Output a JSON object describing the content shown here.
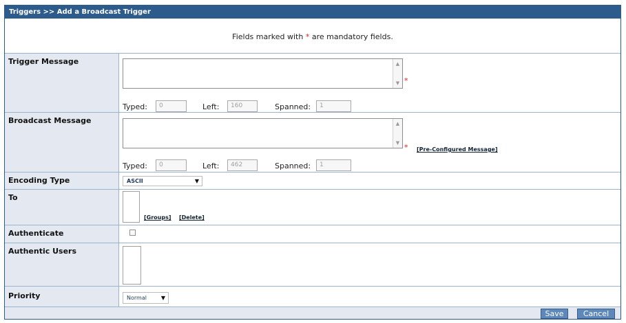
{
  "breadcrumb": "Triggers >> Add a Broadcast Trigger",
  "notice": {
    "before": "Fields marked with",
    "star": "*",
    "after": "are mandatory fields."
  },
  "trigger_message": {
    "label": "Trigger Message",
    "value": "",
    "required_star": "*",
    "typed_label": "Typed:",
    "typed": "0",
    "left_label": "Left:",
    "left": "160",
    "spanned_label": "Spanned:",
    "spanned": "1"
  },
  "broadcast_message": {
    "label": "Broadcast Message",
    "value": "",
    "required_star": "*",
    "preconfigured_link": "[Pre-Configured Message]",
    "typed_label": "Typed:",
    "typed": "0",
    "left_label": "Left:",
    "left": "462",
    "spanned_label": "Spanned:",
    "spanned": "1"
  },
  "encoding": {
    "label": "Encoding Type",
    "selected": "ASCII"
  },
  "to": {
    "label": "To",
    "groups_link": "[Groups]",
    "delete_link": "[Delete]"
  },
  "authenticate": {
    "label": "Authenticate",
    "checked": false
  },
  "authentic_users": {
    "label": "Authentic Users"
  },
  "priority": {
    "label": "Priority",
    "selected": "Normal"
  },
  "buttons": {
    "save": "Save",
    "cancel": "Cancel"
  },
  "colors": {
    "header": "#2d5b8c",
    "label_bg": "#e4e9f1",
    "button": "#5f88ba",
    "required": "#e02020"
  },
  "icons": {
    "scroll_up": "▲",
    "scroll_down": "▼",
    "dropdown": "▼"
  }
}
